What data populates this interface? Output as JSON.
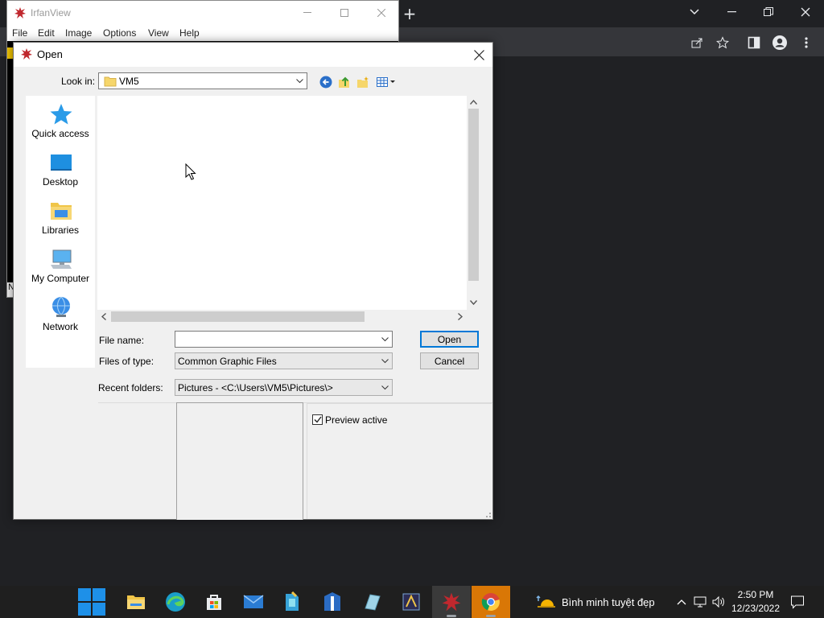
{
  "chrome": {
    "minimize": "⌄",
    "new_tab": "+",
    "minimize_label": "—",
    "restore_label": "❐",
    "close_label": "✕"
  },
  "irfanview": {
    "title": "IrfanView",
    "menu": [
      "File",
      "Edit",
      "Image",
      "Options",
      "View",
      "Help"
    ],
    "status_text": "N"
  },
  "dialog": {
    "title": "Open",
    "look_in_label": "Look in:",
    "look_in_value": "VM5",
    "places": [
      {
        "label": "Quick access",
        "icon": "quick-access-star-icon"
      },
      {
        "label": "Desktop",
        "icon": "desktop-icon"
      },
      {
        "label": "Libraries",
        "icon": "libraries-icon"
      },
      {
        "label": "My Computer",
        "icon": "my-computer-icon"
      },
      {
        "label": "Network",
        "icon": "network-icon"
      }
    ],
    "file_name_label": "File name:",
    "file_name_value": "",
    "files_of_type_label": "Files of type:",
    "files_of_type_value": "Common Graphic Files",
    "recent_folders_label": "Recent folders:",
    "recent_folders_value": "Pictures  -  <C:\\Users\\VM5\\Pictures\\>",
    "open_button": "Open",
    "cancel_button": "Cancel",
    "preview_active_label": "Preview active",
    "preview_active_checked": true
  },
  "taskbar": {
    "weather": "Bình minh tuyệt đẹp",
    "time": "2:50 PM",
    "date": "12/23/2022",
    "apps": [
      "start",
      "file-explorer",
      "edge",
      "store",
      "mail",
      "app-5",
      "app-6",
      "app-7",
      "app-8",
      "irfanview",
      "chrome"
    ]
  }
}
